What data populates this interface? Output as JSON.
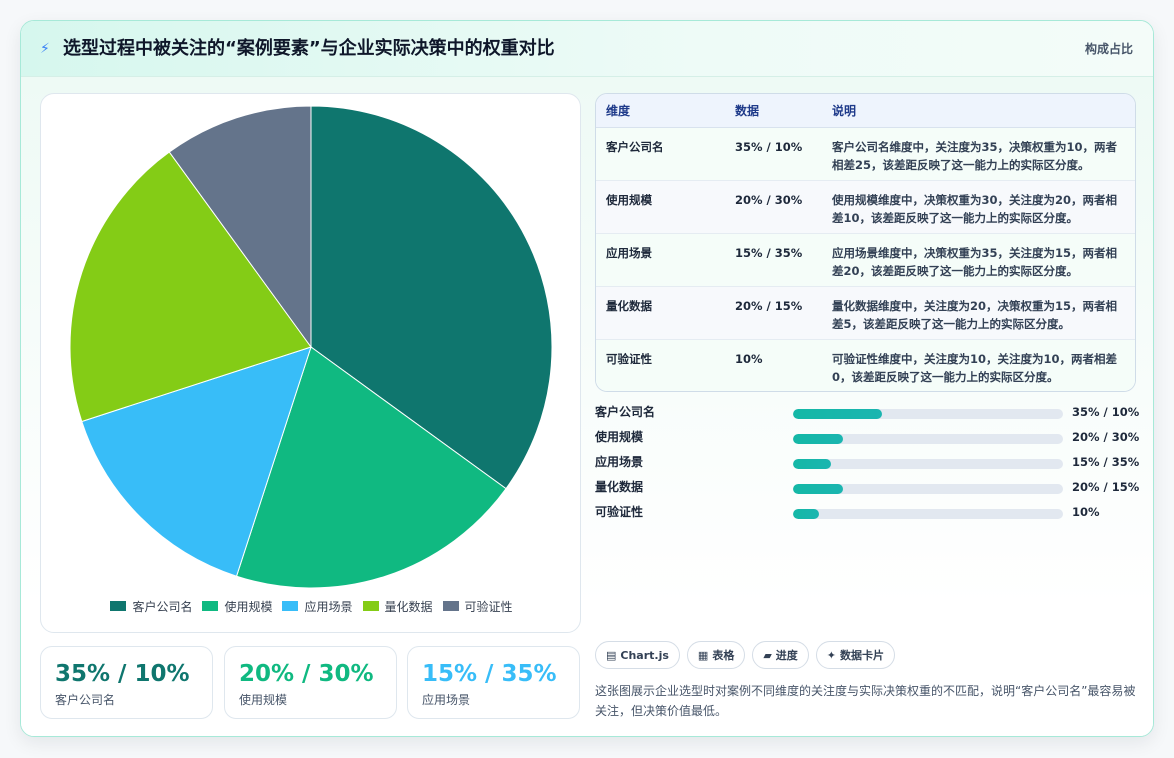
{
  "header": {
    "title": "选型过程中被关注的“案例要素”与企业实际决策中的权重对比",
    "tag": "构成占比"
  },
  "chart_data": {
    "type": "pie",
    "categories": [
      "客户公司名",
      "使用规模",
      "应用场景",
      "量化数据",
      "可验证性"
    ],
    "values": [
      35,
      20,
      15,
      20,
      10
    ],
    "colors": [
      "#0f766e",
      "#10b981",
      "#38bdf8",
      "#84cc16",
      "#64748b"
    ],
    "legend_position": "bottom"
  },
  "kpis": [
    {
      "value": "35% / 10%",
      "label": "客户公司名",
      "color": "#0f766e"
    },
    {
      "value": "20% / 30%",
      "label": "使用规模",
      "color": "#10b981"
    },
    {
      "value": "15% / 35%",
      "label": "应用场景",
      "color": "#38bdf8"
    }
  ],
  "table": {
    "headers": [
      "维度",
      "数据",
      "说明"
    ],
    "rows": [
      {
        "dim": "客户公司名",
        "data": "35% / 10%",
        "desc": "客户公司名维度中，关注度为35，决策权重为10，两者相差25，该差距反映了这一能力上的实际区分度。"
      },
      {
        "dim": "使用规模",
        "data": "20% / 30%",
        "desc": "使用规模维度中，决策权重为30，关注度为20，两者相差10，该差距反映了这一能力上的实际区分度。"
      },
      {
        "dim": "应用场景",
        "data": "15% / 35%",
        "desc": "应用场景维度中，决策权重为35，关注度为15，两者相差20，该差距反映了这一能力上的实际区分度。"
      },
      {
        "dim": "量化数据",
        "data": "20% / 15%",
        "desc": "量化数据维度中，关注度为20，决策权重为15，两者相差5，该差距反映了这一能力上的实际区分度。"
      },
      {
        "dim": "可验证性",
        "data": "10%",
        "desc": "可验证性维度中，关注度为10，关注度为10，两者相差0，该差距反映了这一能力上的实际区分度。"
      }
    ]
  },
  "progress": [
    {
      "name": "客户公司名",
      "value": "35% / 10%",
      "fraction": 0.33
    },
    {
      "name": "使用规模",
      "value": "20% / 30%",
      "fraction": 0.185
    },
    {
      "name": "应用场景",
      "value": "15% / 35%",
      "fraction": 0.14
    },
    {
      "name": "量化数据",
      "value": "20% / 15%",
      "fraction": 0.185
    },
    {
      "name": "可验证性",
      "value": "10%",
      "fraction": 0.095
    }
  ],
  "chips": [
    {
      "icon": "▤",
      "label": "Chart.js"
    },
    {
      "icon": "▦",
      "label": "表格"
    },
    {
      "icon": "▰",
      "label": "进度"
    },
    {
      "icon": "✦",
      "label": "数据卡片"
    }
  ],
  "note": "这张图展示企业选型时对案例不同维度的关注度与实际决策权重的不匹配，说明“客户公司名”最容易被关注，但决策价值最低。"
}
